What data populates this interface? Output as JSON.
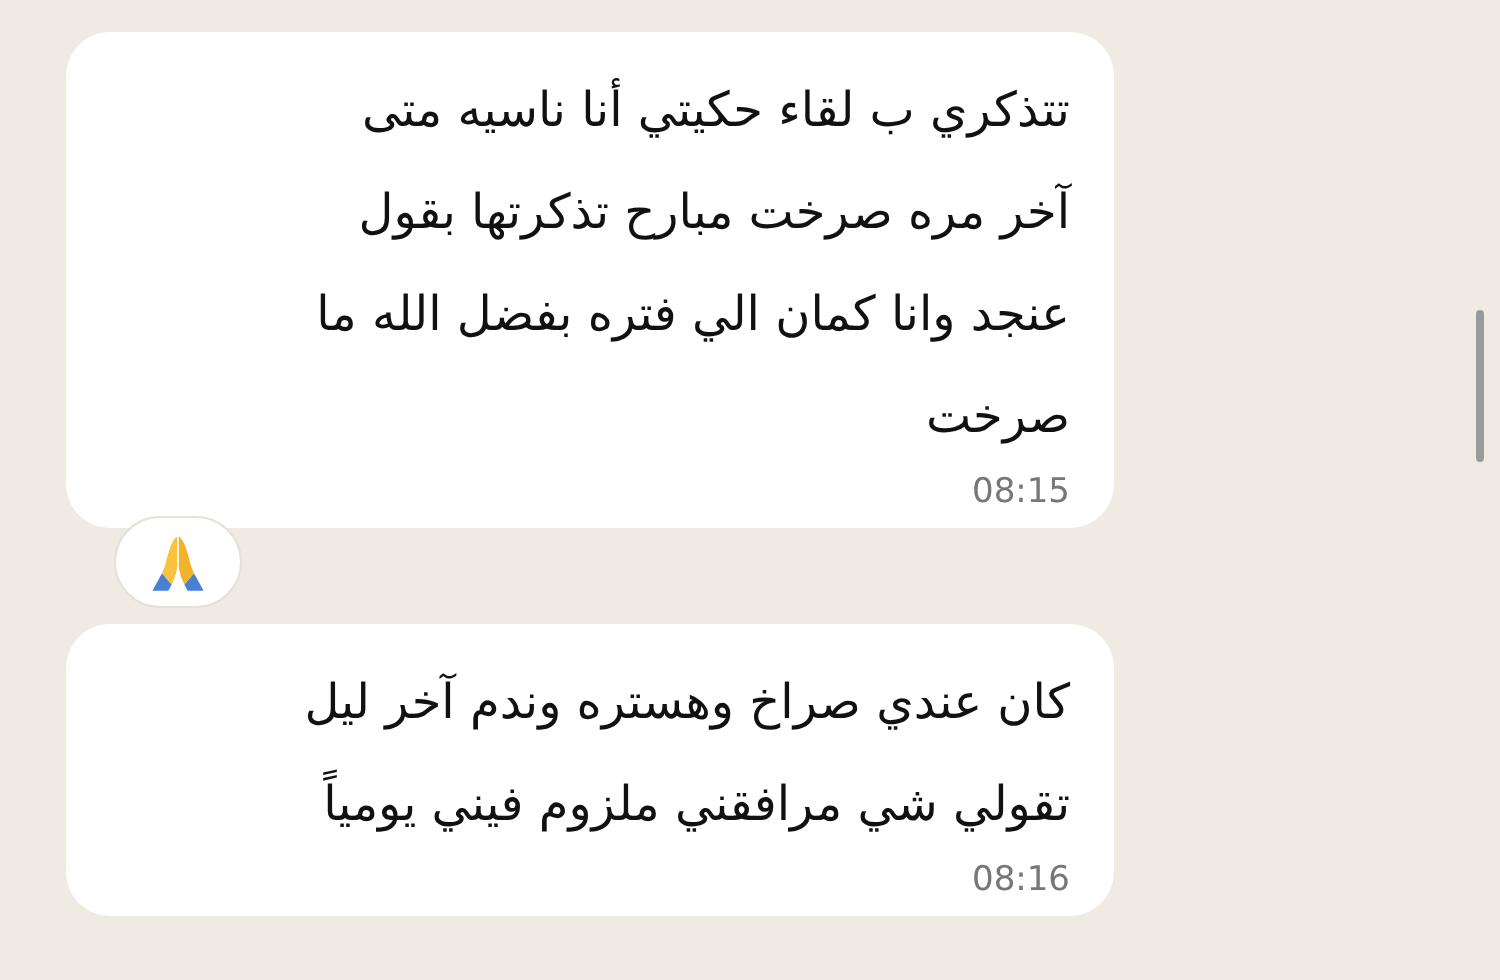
{
  "messages": [
    {
      "lines": [
        "تتذكري ب لقاء حكيتي أنا ناسيه متى",
        "آخر مره صرخت مبارح تذكرتها بقول",
        "عنجد وانا كمان الي فتره بفضل الله ما",
        "صرخت"
      ],
      "time": "08:15",
      "reaction": {
        "kind": "folded-hands"
      }
    },
    {
      "lines": [
        "كان عندي صراخ وهستره وندم آخر ليل",
        "تقولي شي مرافقني ملزوم فيني يومياً"
      ],
      "time": "08:16"
    }
  ]
}
